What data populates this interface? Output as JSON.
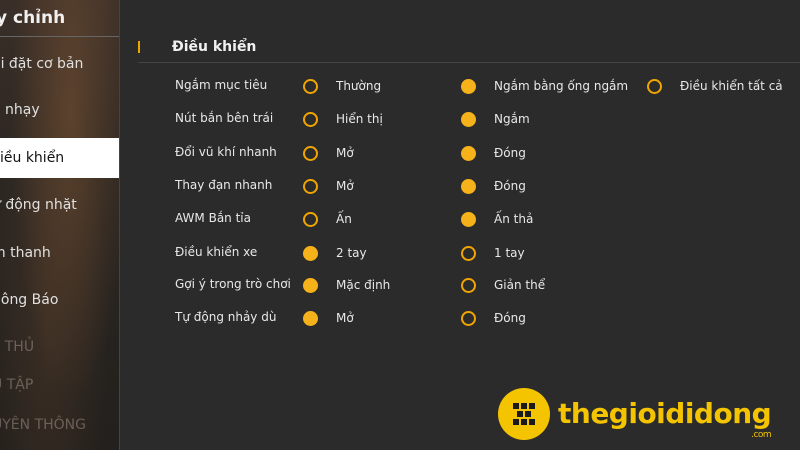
{
  "sidebar": {
    "title": "y chỉnh",
    "items": [
      {
        "label": "ài đặt cơ bản",
        "active": false
      },
      {
        "label": "ộ nhạy",
        "active": false
      },
      {
        "label": "iều khiển",
        "active": true
      },
      {
        "label": "ự động nhặt",
        "active": false
      },
      {
        "label": "m thanh",
        "active": false
      },
      {
        "label": "hông Báo",
        "active": false
      },
      {
        "label": "ỳ THỦ",
        "active": false
      },
      {
        "label": "U TẬP",
        "active": false
      },
      {
        "label": "UYÊN THÔNG",
        "active": false
      }
    ]
  },
  "section": {
    "title": "Điều khiển"
  },
  "settings": [
    {
      "label": "Ngắm mục tiêu",
      "options": [
        {
          "label": "Thường",
          "selected": false
        },
        {
          "label": "Ngắm bằng ống ngắm",
          "selected": true
        },
        {
          "label": "Điều khiển tất cả",
          "selected": false
        }
      ]
    },
    {
      "label": "Nút bắn bên trái",
      "options": [
        {
          "label": "Hiển thị",
          "selected": false
        },
        {
          "label": "Ngắm",
          "selected": true
        }
      ]
    },
    {
      "label": "Đổi vũ khí nhanh",
      "options": [
        {
          "label": "Mở",
          "selected": false
        },
        {
          "label": "Đóng",
          "selected": true
        }
      ]
    },
    {
      "label": "Thay đạn nhanh",
      "options": [
        {
          "label": "Mở",
          "selected": false
        },
        {
          "label": "Đóng",
          "selected": true
        }
      ]
    },
    {
      "label": "AWM Bắn tỉa",
      "options": [
        {
          "label": "Ấn",
          "selected": false
        },
        {
          "label": "Ấn thả",
          "selected": true
        }
      ]
    },
    {
      "label": "Điều khiển xe",
      "options": [
        {
          "label": "2 tay",
          "selected": true
        },
        {
          "label": "1 tay",
          "selected": false
        }
      ]
    },
    {
      "label": "Gợi ý trong trò chơi",
      "options": [
        {
          "label": "Mặc định",
          "selected": true
        },
        {
          "label": "Giản thể",
          "selected": false
        }
      ]
    },
    {
      "label": "Tự động nhảy dù",
      "options": [
        {
          "label": "Mở",
          "selected": true
        },
        {
          "label": "Đóng",
          "selected": false
        }
      ]
    }
  ],
  "colors": {
    "accent": "#f5b21a",
    "background": "#2b2b2b"
  },
  "watermark": {
    "brand": "thegioididong",
    "suffix": ".com"
  }
}
